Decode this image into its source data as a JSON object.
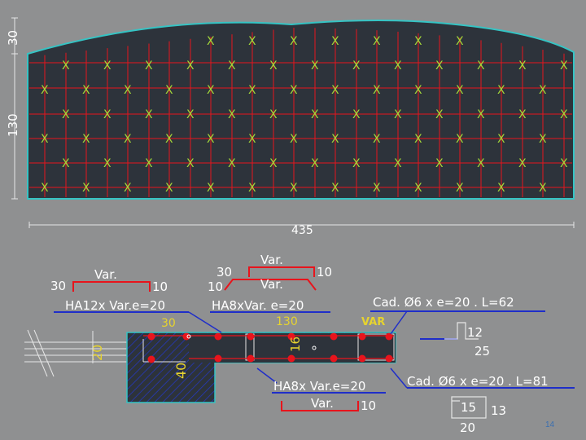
{
  "plan": {
    "dim_top": "30",
    "dim_height": "130",
    "dim_length": "435",
    "grid_mark": "X"
  },
  "section": {
    "top_left_bar": {
      "var_label": "Var.",
      "left_leg": "30",
      "right_leg": "10",
      "caption": "HA12x Var.e=20"
    },
    "top_mid_bar": {
      "var_label_top": "Var.",
      "left_leg": "30",
      "right_leg": "10",
      "var_label_bottom": "Var.",
      "left_leg_bottom": "10",
      "caption": "HA8xVar. e=20"
    },
    "dims": {
      "slab_left": "30",
      "slab_width": "130",
      "var_tag": "VAR",
      "slab_thick": "20",
      "beam_depth": "40",
      "hook_height": "16"
    },
    "stirrup_top": {
      "caption": "Cad. Ø6 x e=20 . L=62",
      "h": "12",
      "w": "25"
    },
    "bottom_bar": {
      "caption": "HA8x Var.e=20",
      "var_label": "Var.",
      "right_leg": "10"
    },
    "stirrup_bottom": {
      "caption": "Cad. Ø6 x e=20 . L=81",
      "h": "15",
      "side": "13",
      "w": "20"
    }
  },
  "colors": {
    "background": "#8f9091",
    "slab_fill": "#2d333b",
    "outline": "#35c4c4",
    "rebar": "#e8141c",
    "cross": "#a4d83a",
    "blue_line": "#1f2ec9",
    "hatch": "#2538b8",
    "dim_line": "#e6e6e6"
  },
  "footer": {
    "page_number": "14"
  }
}
